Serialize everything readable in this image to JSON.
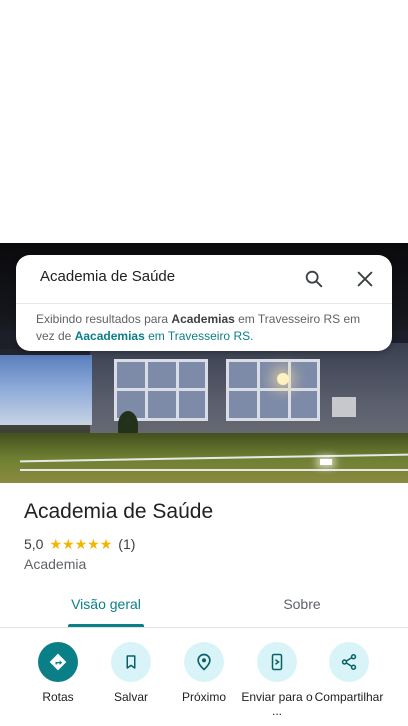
{
  "search": {
    "query": "Academia de Saúde",
    "notice": {
      "prefix": "Exibindo resultados para ",
      "shown_term": "Academias",
      "middle": " em Travesseiro RS em vez de ",
      "original_term": "Aacademias",
      "suffix": " em Travesseiro RS."
    }
  },
  "place": {
    "title": "Academia de Saúde",
    "rating": "5,0",
    "stars": 5,
    "review_count": "(1)",
    "category": "Academia"
  },
  "tabs": [
    {
      "label": "Visão geral",
      "active": true
    },
    {
      "label": "Sobre",
      "active": false
    }
  ],
  "actions": [
    {
      "label": "Rotas",
      "icon": "directions-icon"
    },
    {
      "label": "Salvar",
      "icon": "bookmark-icon"
    },
    {
      "label": "Próximo",
      "icon": "nearby-icon"
    },
    {
      "label": "Enviar para o ...",
      "icon": "send-to-phone-icon"
    },
    {
      "label": "Compartilhar",
      "icon": "share-icon"
    }
  ],
  "colors": {
    "accent": "#0b7f88",
    "action_bg": "#d8f4f8",
    "star": "#f4b400"
  }
}
